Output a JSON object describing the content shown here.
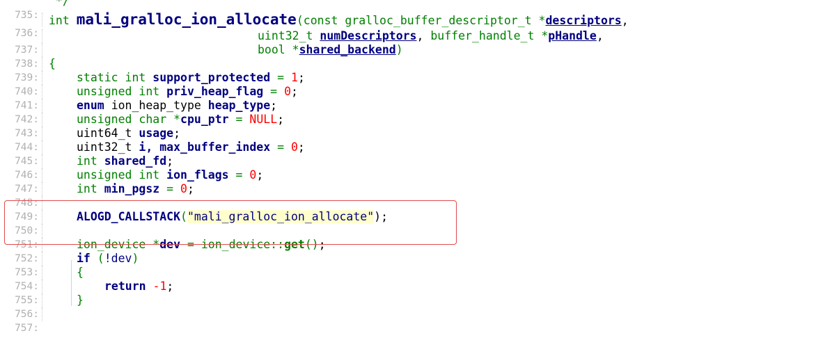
{
  "lines": [
    {
      "n": "735:",
      "code": " */"
    },
    {
      "n": "736:",
      "code": "int mali_gralloc_ion_allocate(const gralloc_buffer_descriptor_t *descriptors,"
    },
    {
      "n": "737:",
      "code": "uint32_t numDescriptors, buffer_handle_t *pHandle,"
    },
    {
      "n": "738:",
      "code": "bool *shared_backend)"
    },
    {
      "n": "739:",
      "code": "{"
    },
    {
      "n": "740:",
      "code": "static int support_protected = 1;"
    },
    {
      "n": "741:",
      "code": "unsigned int priv_heap_flag = 0;"
    },
    {
      "n": "742:",
      "code": "enum ion_heap_type heap_type;"
    },
    {
      "n": "743:",
      "code": "unsigned char *cpu_ptr = NULL;"
    },
    {
      "n": "744:",
      "code": "uint64_t usage;"
    },
    {
      "n": "745:",
      "code": "uint32_t i, max_buffer_index = 0;"
    },
    {
      "n": "746:",
      "code": "int shared_fd;"
    },
    {
      "n": "747:",
      "code": "unsigned int ion_flags = 0;"
    },
    {
      "n": "748:",
      "code": "int min_pgsz = 0;"
    },
    {
      "n": "749:",
      "code": ""
    },
    {
      "n": "750:",
      "code": "ALOGD_CALLSTACK(\"mali_gralloc_ion_allocate\");"
    },
    {
      "n": "751:",
      "code": ""
    },
    {
      "n": "752:",
      "code": "ion_device *dev = ion_device::get();"
    },
    {
      "n": "753:",
      "code": "if (!dev)"
    },
    {
      "n": "754:",
      "code": "{"
    },
    {
      "n": "755:",
      "code": "return -1;"
    },
    {
      "n": "756:",
      "code": "}"
    },
    {
      "n": "757:",
      "code": ""
    }
  ],
  "tokens": {
    "l735": [
      " */"
    ],
    "l736": [
      "int",
      " ",
      "mali_gralloc_ion_allocate",
      "(",
      "const",
      " ",
      "gralloc_buffer_descriptor_t",
      " *",
      "descriptors",
      ","
    ],
    "l737": [
      "uint32_t",
      " ",
      "numDescriptors",
      ", ",
      "buffer_handle_t",
      " *",
      "pHandle",
      ","
    ],
    "l738": [
      "bool",
      " *",
      "shared_backend",
      ")"
    ],
    "l739": [
      "{"
    ],
    "l740": [
      "static",
      " ",
      "int",
      " ",
      "support_protected",
      " = ",
      "1",
      ";"
    ],
    "l741": [
      "unsigned",
      " ",
      "int",
      " ",
      "priv_heap_flag",
      " = ",
      "0",
      ";"
    ],
    "l742": [
      "enum",
      " ",
      "ion_heap_type",
      " ",
      "heap_type",
      ";"
    ],
    "l743": [
      "unsigned",
      " ",
      "char",
      " *",
      "cpu_ptr",
      " = ",
      "NULL",
      ";"
    ],
    "l744": [
      "uint64_t",
      " ",
      "usage",
      ";"
    ],
    "l745": [
      "uint32_t",
      " ",
      "i, max_buffer_index",
      " = ",
      "0",
      ";"
    ],
    "l746": [
      "int",
      " ",
      "shared_fd",
      ";"
    ],
    "l747": [
      "unsigned",
      " ",
      "int",
      " ",
      "ion_flags",
      " = ",
      "0",
      ";"
    ],
    "l748": [
      "int",
      " ",
      "min_pgsz",
      " = ",
      "0",
      ";"
    ],
    "l750": [
      "ALOGD_CALLSTACK",
      "(",
      "\"mali_gralloc_ion_allocate\"",
      ");"
    ],
    "l752": [
      "ion_device",
      " *",
      "dev",
      " = ",
      "ion_device::",
      "get",
      "()",
      ";"
    ],
    "l753": [
      "if",
      " (",
      "!dev",
      ")"
    ],
    "l754": [
      "{"
    ],
    "l755": [
      "return",
      " ",
      "-1",
      ";"
    ],
    "l756": [
      "}"
    ]
  },
  "colors": {
    "keyword": "#008000",
    "identifier": "#000080",
    "number": "#ff0000",
    "highlight_border": "#e04a4a",
    "line_number": "#b0b0b0"
  }
}
